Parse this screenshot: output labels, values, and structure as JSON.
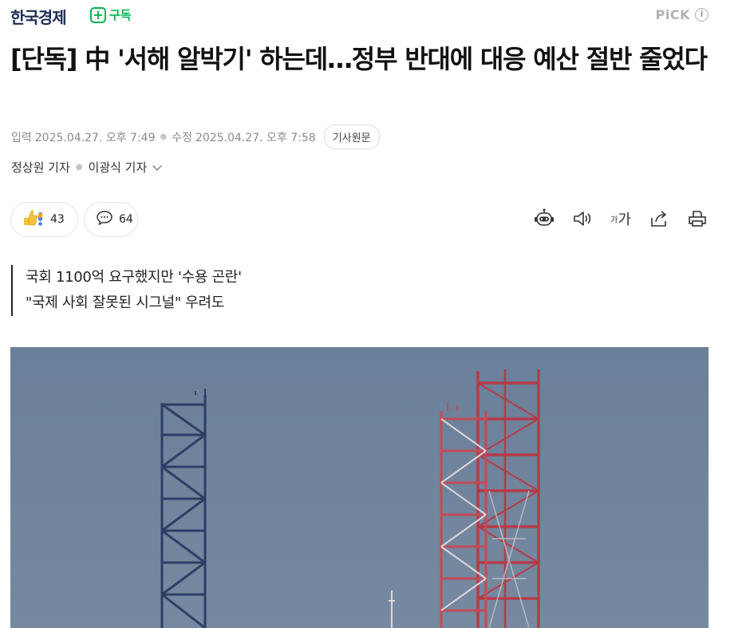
{
  "header": {
    "press_name": "한국경제",
    "subscribe_label": "구독",
    "pick_label": "PiCK",
    "pick_info": "i"
  },
  "article": {
    "title": "[단독] 中 '서해 알박기' 하는데…정부 반대에 대응 예산 절반 줄었다",
    "input_label": "입력",
    "input_time": "2025.04.27. 오후 7:49",
    "modified_label": "수정",
    "modified_time": "2025.04.27. 오후 7:58",
    "source_button": "기사원문",
    "authors": [
      "정상원 기자",
      "이광식 기자"
    ],
    "reaction_count": "43",
    "comment_count": "64",
    "font_size_small": "가",
    "font_size_large": "가",
    "summary": [
      "국회 1100억 요구했지만 '수용 곤란'",
      "\"국제 사회 잘못된 시그널\" 우려도"
    ]
  },
  "colors": {
    "subscribe_green": "#00b551",
    "press_navy": "#1d2c58",
    "photo_sky": "#6f839b"
  }
}
